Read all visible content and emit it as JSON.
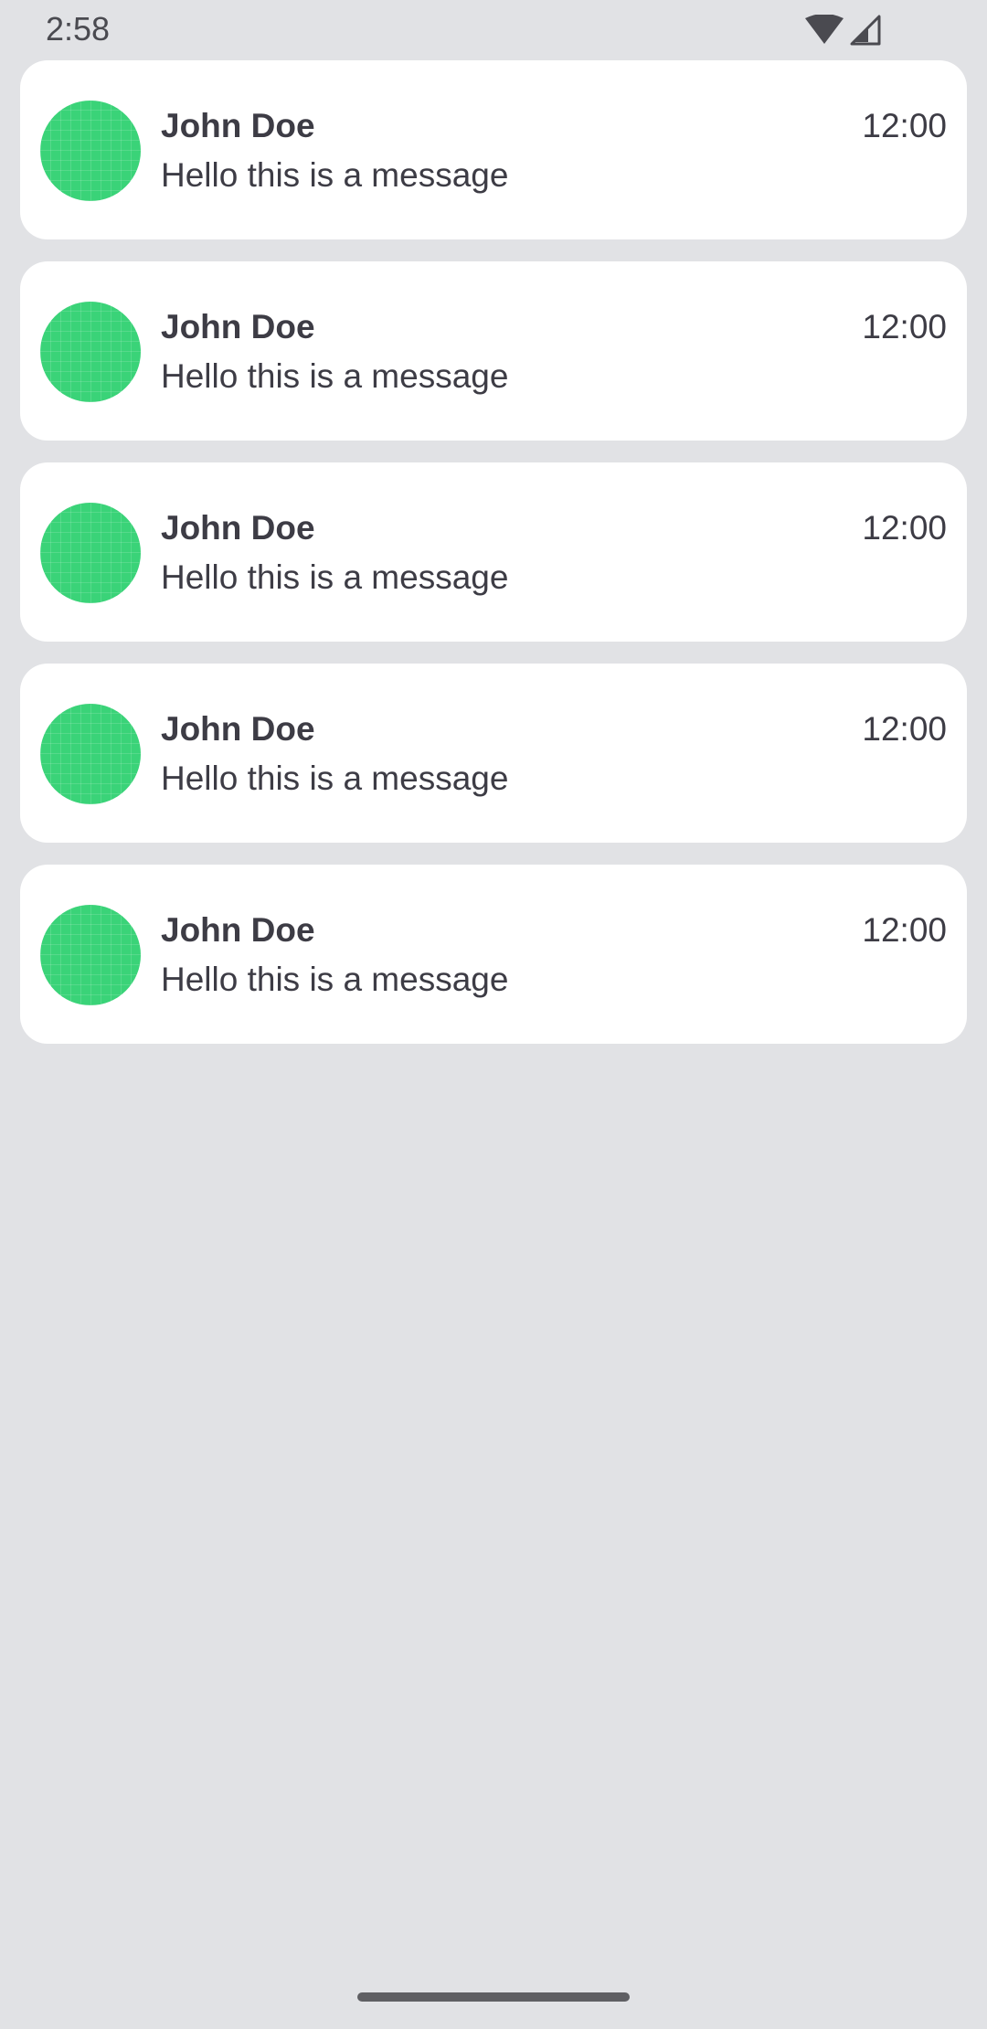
{
  "status_bar": {
    "time": "2:58",
    "icons": [
      "wifi-icon",
      "cellular-signal-icon"
    ]
  },
  "theme": {
    "background": "#e1e2e5",
    "card": "#ffffff",
    "avatar": "#3ad378",
    "text": "#3d3c45"
  },
  "messages": [
    {
      "name": "John Doe",
      "text": "Hello this is a message",
      "time": "12:00"
    },
    {
      "name": "John Doe",
      "text": "Hello this is a message",
      "time": "12:00"
    },
    {
      "name": "John Doe",
      "text": "Hello this is a message",
      "time": "12:00"
    },
    {
      "name": "John Doe",
      "text": "Hello this is a message",
      "time": "12:00"
    },
    {
      "name": "John Doe",
      "text": "Hello this is a message",
      "time": "12:00"
    }
  ]
}
